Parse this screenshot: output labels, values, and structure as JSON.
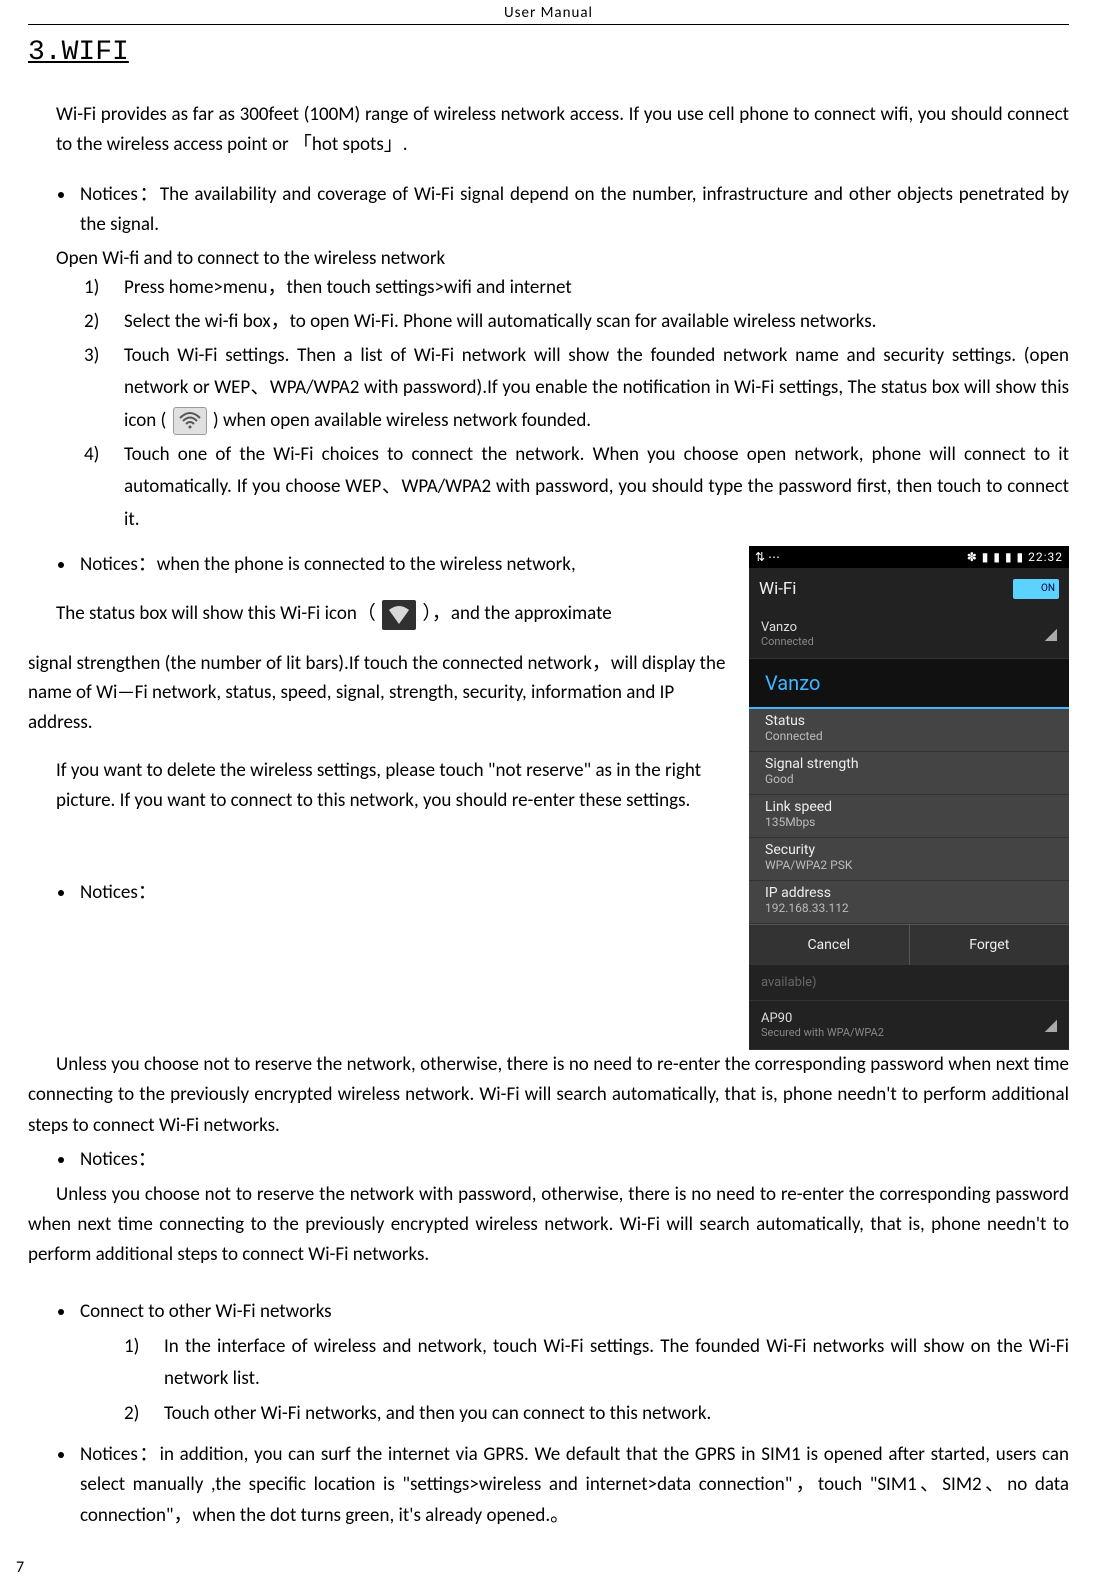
{
  "header": "User  Manual",
  "section_title": "3.WIFI",
  "intro": "Wi-Fi provides as far as 300feet (100M) range of wireless network access. If you use cell phone to connect wifi, you should connect to the wireless access point or 「hot spots」.",
  "notice_avail": "Notices：The availability and coverage of Wi-Fi signal depend on the number, infrastructure and other objects penetrated by the signal.",
  "open_line": "Open Wi-fi and to connect to the wireless network",
  "steps": {
    "s1": "Press home>menu，then touch settings>wifi and internet",
    "s2": "Select the wi-fi box，to open Wi-Fi. Phone will automatically scan for available wireless networks.",
    "s3a": "Touch Wi-Fi settings. Then a list of Wi-Fi network will show the founded network name and security settings. (open network or WEP、WPA/WPA2 with password).If you enable the notification in  Wi-Fi settings, The status box will show this icon (",
    "s3b": ") when open available wireless network founded.",
    "s4": "Touch one of the Wi-Fi choices to connect the network. When you choose open network, phone will connect to it automatically. If you choose WEP、WPA/WPA2 with password, you should type the password first, then touch to connect it."
  },
  "notice_connected": "Notices：when the phone is connected to the wireless network,",
  "status_line_a": "The status box will show this Wi-Fi icon（",
  "status_line_b": "），and the approximate",
  "status_para": "signal strengthen (the number of lit bars).If touch the connected network，will display the name of Wi—Fi  network, status, speed,  signal, strength, security, information and IP address.",
  "delete_para": "If you want to delete the wireless settings, please touch \"not reserve\" as in the right picture. If you want to connect to this network, you should re-enter these settings.",
  "notices3_label": "Notices：",
  "notices3_para": "Unless you choose not to reserve the network, otherwise, there is no need to re-enter the corresponding password when next time connecting to the previously encrypted wireless network. Wi-Fi will search automatically, that is, phone needn't to perform additional steps to connect Wi-Fi networks.",
  "notices4_label": "Notices：",
  "notices4_para": "Unless you choose not to reserve the network with password, otherwise, there is no need to re-enter the corresponding password when next time connecting to the previously encrypted wireless network. Wi-Fi will search automatically, that is, phone needn't to perform additional steps to connect Wi-Fi networks.",
  "connect_other_label": "Connect to other Wi-Fi networks",
  "connect_other_steps": {
    "c1": "In the interface of wireless and network, touch Wi-Fi settings. The founded Wi-Fi networks will show on the Wi-Fi network list.",
    "c2": "Touch other Wi-Fi networks, and then you can connect to this network."
  },
  "gprs_notice": "Notices：in addition, you can surf the internet via GPRS. We default that the GPRS in SIM1 is opened after started, users can select manually ,the specific location is \"settings>wireless and internet>data connection\"，touch \"SIM1、SIM2、no data connection\"，when the dot turns green, it's already opened.。",
  "page_number": "7",
  "phone": {
    "statusbar": {
      "left": "⇅ ⋯",
      "right": "✽ ▮ ▮ ▮ ▮ 22:32"
    },
    "actionbar": {
      "title": "Wi-Fi",
      "toggle": "ON"
    },
    "list_top": {
      "name": "Vanzo",
      "sub": "Connected"
    },
    "dialog": {
      "title": "Vanzo",
      "rows": [
        {
          "label": "Status",
          "value": "Connected"
        },
        {
          "label": "Signal strength",
          "value": "Good"
        },
        {
          "label": "Link speed",
          "value": "135Mbps"
        },
        {
          "label": "Security",
          "value": "WPA/WPA2 PSK"
        },
        {
          "label": "IP address",
          "value": "192.168.33.112"
        }
      ],
      "btn_cancel": "Cancel",
      "btn_forget": "Forget"
    },
    "list_bottom1": {
      "name": "available)",
      "sub": ""
    },
    "list_bottom2": {
      "name": "AP90",
      "sub": "Secured with WPA/WPA2"
    }
  }
}
